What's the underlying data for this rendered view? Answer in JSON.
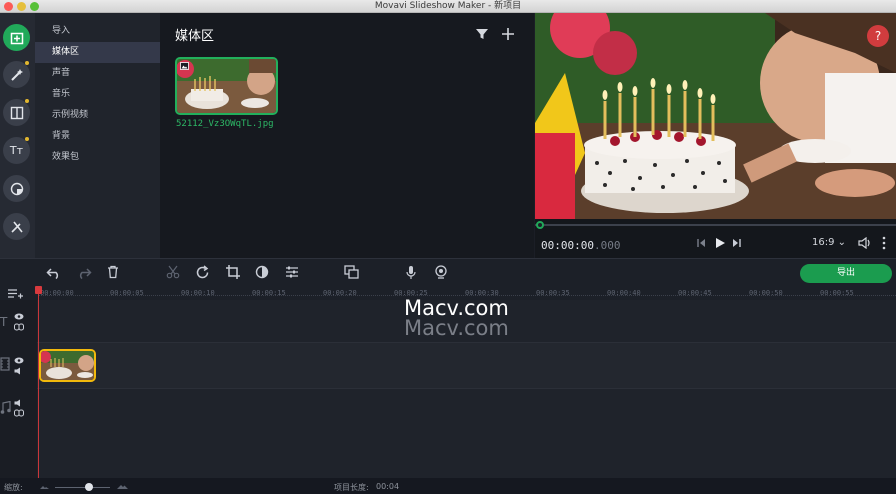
{
  "window": {
    "title": "Movavi Slideshow Maker - 新项目",
    "traffic_lights": [
      "#fc5b57",
      "#e5bf3c",
      "#57c038"
    ]
  },
  "left_toolbar": [
    {
      "icon": "import-icon",
      "active": true
    },
    {
      "icon": "magic-wand-icon",
      "badge": true
    },
    {
      "icon": "transition-icon",
      "badge": true
    },
    {
      "icon": "titles-icon",
      "badge": true
    },
    {
      "icon": "sticker-icon"
    },
    {
      "icon": "tools-icon"
    }
  ],
  "sidebar": {
    "items": [
      {
        "label": "导入"
      },
      {
        "label": "媒体区"
      },
      {
        "label": "声音"
      },
      {
        "label": "音乐"
      },
      {
        "label": "示例视频"
      },
      {
        "label": "背景"
      },
      {
        "label": "效果包"
      }
    ],
    "selected_index": 1
  },
  "media": {
    "title": "媒体区",
    "files": [
      {
        "name": "52112_Vz3OWqTL.jpg"
      }
    ]
  },
  "preview": {
    "help_label": "?",
    "time_main": "00:00:00",
    "time_ms": ".000",
    "aspect": "16:9",
    "aspect_caret": "⌄"
  },
  "timeline": {
    "export_label": "导出",
    "ruler_ticks": [
      "00:00:00",
      "00:00:05",
      "00:00:10",
      "00:00:15",
      "00:00:20",
      "00:00:25",
      "00:00:30",
      "00:00:35",
      "00:00:40",
      "00:00:45",
      "00:00:50",
      "00:00:55"
    ],
    "watermark": "Macv.com"
  },
  "status": {
    "zoom_label": "缩放:",
    "project_length_label": "项目长度:",
    "project_length": "00:04"
  },
  "colors": {
    "accent_green": "#21a95a",
    "playhead_red": "#d83a3e",
    "clip_border": "#f2b90c"
  }
}
